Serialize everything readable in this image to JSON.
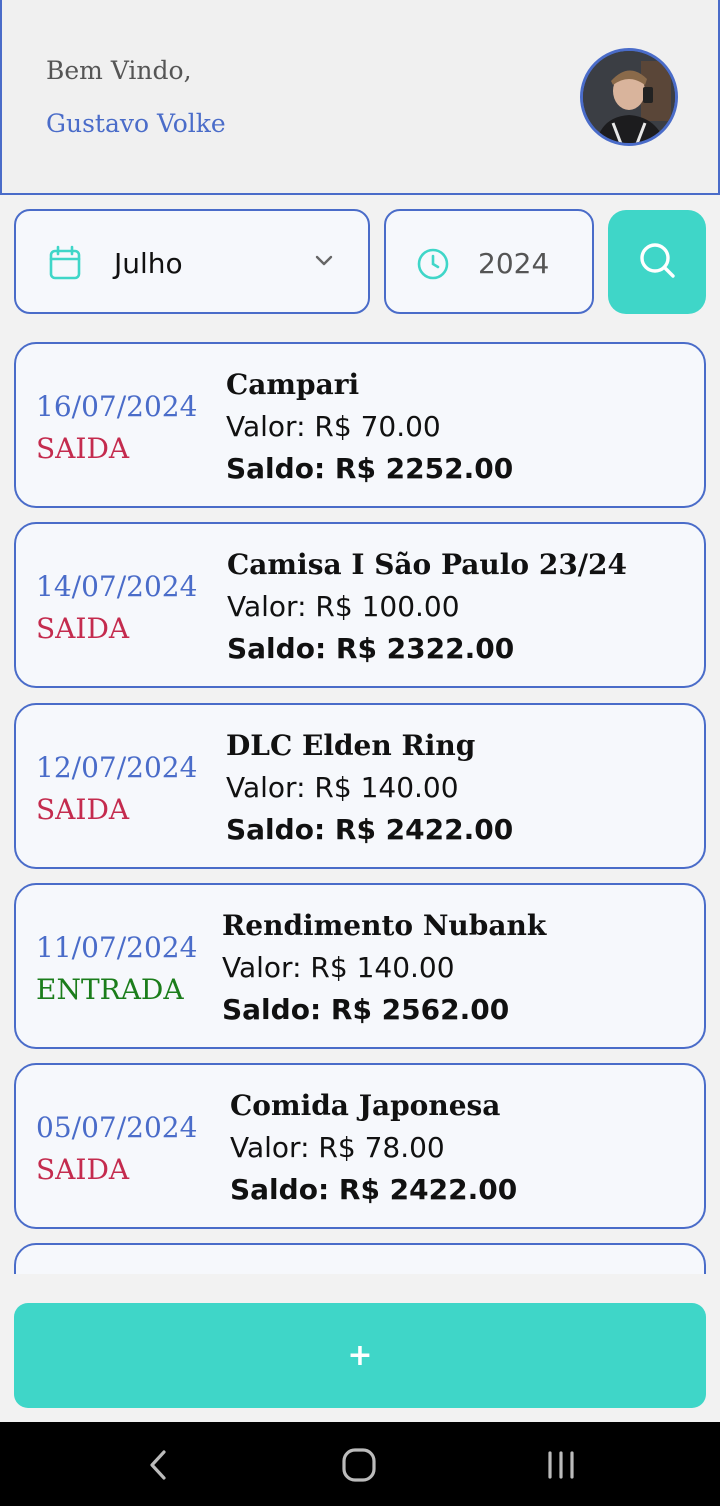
{
  "header": {
    "greeting": "Bem Vindo,",
    "user_name": "Gustavo Volke",
    "avatar_icon": "user-avatar"
  },
  "filters": {
    "month": "Julho",
    "month_icon": "calendar-icon",
    "year": "2024",
    "year_icon": "clock-icon",
    "search_icon": "search-icon"
  },
  "colors": {
    "accent": "#3fd6c8",
    "border_blue": "#4a6cc9",
    "saida": "#c42b4e",
    "entrada": "#1b7d1b"
  },
  "transactions": [
    {
      "date": "16/07/2024",
      "type": "SAIDA",
      "description": "Campari",
      "valor": "Valor: R$ 70.00",
      "saldo": "Saldo: R$ 2252.00"
    },
    {
      "date": "14/07/2024",
      "type": "SAIDA",
      "description": "Camisa I São Paulo 23/24",
      "valor": "Valor: R$ 100.00",
      "saldo": "Saldo: R$ 2322.00"
    },
    {
      "date": "12/07/2024",
      "type": "SAIDA",
      "description": "DLC Elden Ring",
      "valor": "Valor: R$ 140.00",
      "saldo": "Saldo: R$ 2422.00"
    },
    {
      "date": "11/07/2024",
      "type": "ENTRADA",
      "description": "Rendimento Nubank",
      "valor": "Valor: R$ 140.00",
      "saldo": "Saldo: R$ 2562.00"
    },
    {
      "date": "05/07/2024",
      "type": "SAIDA",
      "description": "Comida Japonesa",
      "valor": "Valor: R$ 78.00",
      "saldo": "Saldo: R$ 2422.00"
    }
  ],
  "add_button": {
    "label": "+"
  },
  "navbar": {
    "back_icon": "back-icon",
    "home_icon": "home-icon",
    "recents_icon": "recents-icon"
  }
}
